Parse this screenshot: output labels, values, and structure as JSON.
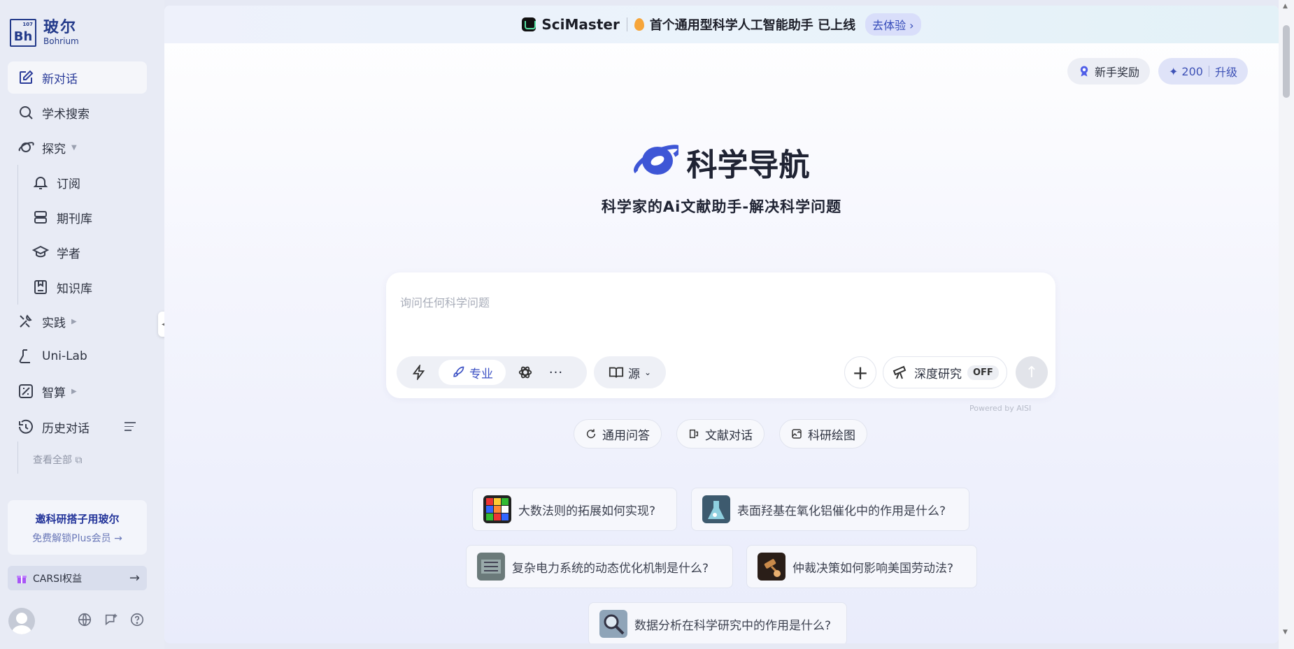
{
  "sidebar": {
    "logo": {
      "mark_top": "107",
      "mark": "Bh",
      "name_cn": "玻尔",
      "name_en": "Bohrium"
    },
    "items": [
      {
        "label": "新对话",
        "icon": "edit-icon"
      },
      {
        "label": "学术搜索",
        "icon": "search-icon"
      },
      {
        "label": "探究",
        "icon": "planet-icon"
      },
      {
        "label": "订阅",
        "icon": "bell-icon"
      },
      {
        "label": "期刊库",
        "icon": "database-icon"
      },
      {
        "label": "学者",
        "icon": "graduation-cap-icon"
      },
      {
        "label": "知识库",
        "icon": "book-save-icon"
      },
      {
        "label": "实践",
        "icon": "tools-icon"
      },
      {
        "label": "Uni-Lab",
        "icon": "lab-flask-icon"
      },
      {
        "label": "智算",
        "icon": "compute-icon"
      },
      {
        "label": "历史对话",
        "icon": "history-icon"
      }
    ],
    "view_all": "查看全部",
    "invite": {
      "title": "邀科研搭子用玻尔",
      "subtitle": "免费解锁Plus会员 →"
    },
    "carsi": {
      "label": "CARSI权益",
      "arrow": "→"
    }
  },
  "banner": {
    "brand": "SciMaster",
    "text": "首个通用型科学人工智能助手 已上线",
    "cta": "去体验 ›"
  },
  "header": {
    "reward": "新手奖励",
    "points": "200",
    "upgrade": "升级"
  },
  "hero": {
    "title": "科学导航",
    "subtitle": "科学家的Ai文献助手-解决科学问题"
  },
  "composer": {
    "placeholder": "询问任何科学问题",
    "mode_active": "专业",
    "source": "源",
    "deep_research": "深度研究",
    "deep_state": "OFF",
    "powered_by": "Powered by AISI"
  },
  "chips": [
    "通用问答",
    "文献对话",
    "科研绘图"
  ],
  "questions": [
    "大数法则的拓展如何实现?",
    "表面羟基在氧化铝催化中的作用是什么?",
    "复杂电力系统的动态优化机制是什么?",
    "仲裁决策如何影响美国劳动法?",
    "数据分析在科学研究中的作用是什么?"
  ],
  "colors": {
    "accent": "#3d52c4",
    "brand_dark": "#233a8a"
  }
}
